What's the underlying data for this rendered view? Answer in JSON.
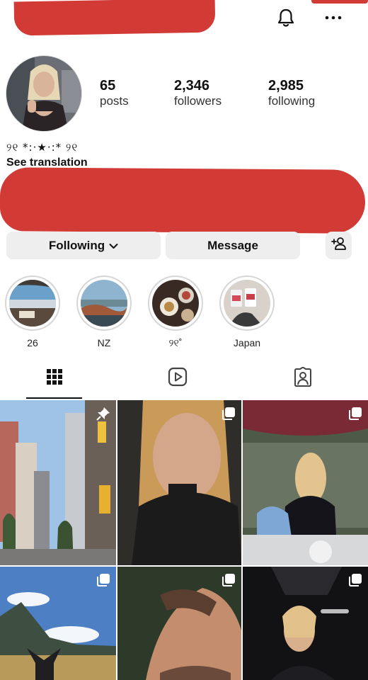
{
  "header": {
    "bell_icon": "bell-icon",
    "more_icon": "more-horizontal-icon"
  },
  "profile": {
    "stats": {
      "posts": {
        "value": "65",
        "label": "posts"
      },
      "followers": {
        "value": "2,346",
        "label": "followers"
      },
      "following": {
        "value": "2,985",
        "label": "following"
      }
    },
    "bio_decoration": "୨୧ *:·★·:* ୨୧",
    "see_translation": "See translation"
  },
  "actions": {
    "following_label": "Following",
    "message_label": "Message",
    "add_user_icon": "add-user-icon"
  },
  "highlights": [
    {
      "label": "26"
    },
    {
      "label": "NZ"
    },
    {
      "label": "୨୧˚"
    },
    {
      "label": "Japan"
    }
  ],
  "tabs": {
    "grid_icon": "grid-icon",
    "reels_icon": "reels-icon",
    "tagged_icon": "tagged-icon"
  },
  "colors": {
    "redaction": "#d23a36",
    "button_bg": "#eeeeef",
    "text": "#111111"
  }
}
